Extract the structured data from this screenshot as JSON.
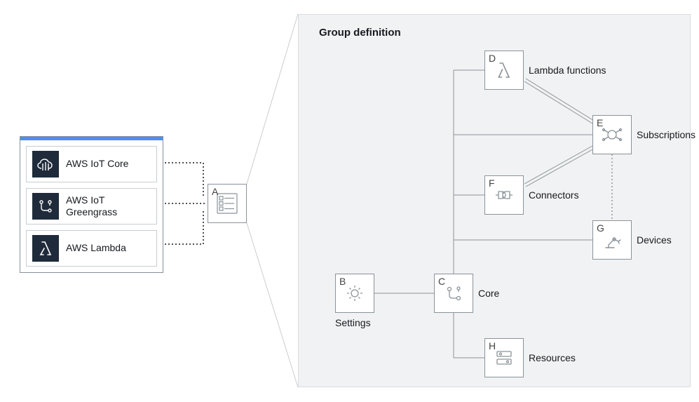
{
  "services": {
    "items": [
      {
        "label": "AWS IoT Core",
        "icon": "aws-iot-core-icon"
      },
      {
        "label": "AWS IoT Greengrass",
        "icon": "aws-iot-greengrass-icon"
      },
      {
        "label": "AWS Lambda",
        "icon": "aws-lambda-icon"
      }
    ]
  },
  "nodes": {
    "A": {
      "letter": "A",
      "label": ""
    },
    "B": {
      "letter": "B",
      "label": "Settings"
    },
    "C": {
      "letter": "C",
      "label": "Core"
    },
    "D": {
      "letter": "D",
      "label": "Lambda functions"
    },
    "E": {
      "letter": "E",
      "label": "Subscriptions"
    },
    "F": {
      "letter": "F",
      "label": "Connectors"
    },
    "G": {
      "letter": "G",
      "label": "Devices"
    },
    "H": {
      "letter": "H",
      "label": "Resources"
    }
  },
  "group": {
    "title": "Group definition"
  }
}
